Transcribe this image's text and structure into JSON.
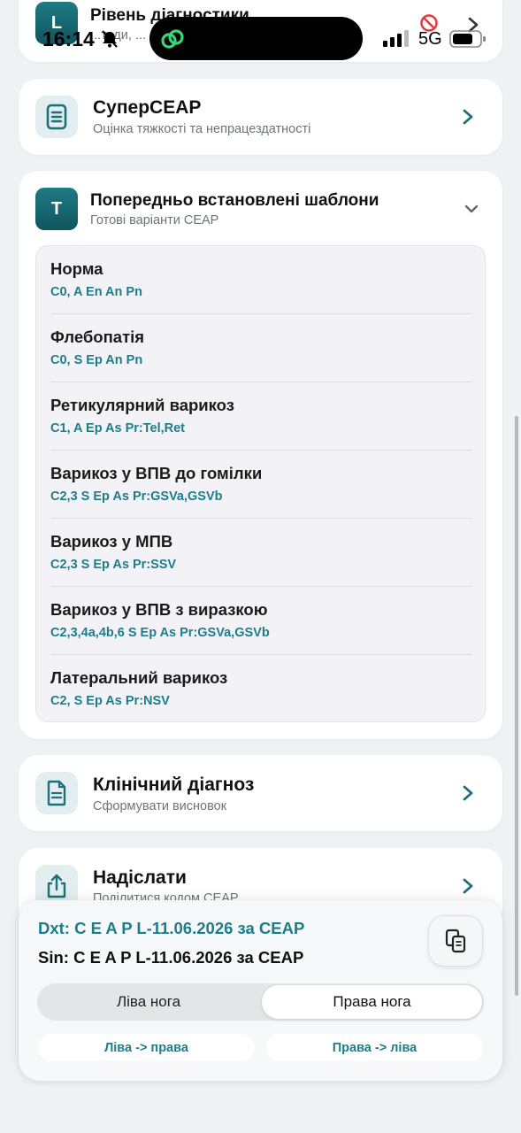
{
  "status_bar": {
    "time": "16:14",
    "network": "5G"
  },
  "diagnostics_card": {
    "letter": "L",
    "title": "Рівень діагностики",
    "subtitle": "...тоди, ..."
  },
  "superceap_card": {
    "icon": "document-list-icon",
    "title": "СуперCEAP",
    "subtitle": "Оцінка тяжкості та непрацездатності"
  },
  "templates_card": {
    "letter": "T",
    "title": "Попередньо встановлені шаблони",
    "subtitle": "Готові варіанти CEAP",
    "items": [
      {
        "name": "Норма",
        "code": "C0, A En An Pn"
      },
      {
        "name": "Флебопатія",
        "code": "C0, S Ep An Pn"
      },
      {
        "name": "Ретикулярний варикоз",
        "code": "C1, A Ep As Pr:Tel,Ret"
      },
      {
        "name": "Варикоз у ВПВ до гомілки",
        "code": "C2,3 S Ep As Pr:GSVa,GSVb"
      },
      {
        "name": "Варикоз у МПВ",
        "code": "C2,3 S Ep As Pr:SSV"
      },
      {
        "name": "Варикоз у ВПВ з виразкою",
        "code": "C2,3,4a,4b,6 S Ep As Pr:GSVa,GSVb"
      },
      {
        "name": "Латеральний варикоз",
        "code": "C2, S Ep As Pr:NSV"
      }
    ]
  },
  "clinical_card": {
    "icon": "document-lines-icon",
    "title": "Клінічний діагноз",
    "subtitle": "Сформувати висновок"
  },
  "send_card": {
    "icon": "share-icon",
    "title": "Надіслати",
    "subtitle": "Поділитися кодом CEAP"
  },
  "bottom_panel": {
    "dxt": "Dxt: C E A P L-11.06.2026 за CEAP",
    "sin": "Sin: C E A P L-11.06.2026 за CEAP",
    "segment_left": "Ліва нога",
    "segment_right": "Права нога",
    "swap_left_to_right": "Ліва -> права",
    "swap_right_to_left": "Права -> ліва"
  },
  "colors": {
    "accent": "#1d7d8a",
    "background": "#eef2f4",
    "card": "#ffffff"
  }
}
